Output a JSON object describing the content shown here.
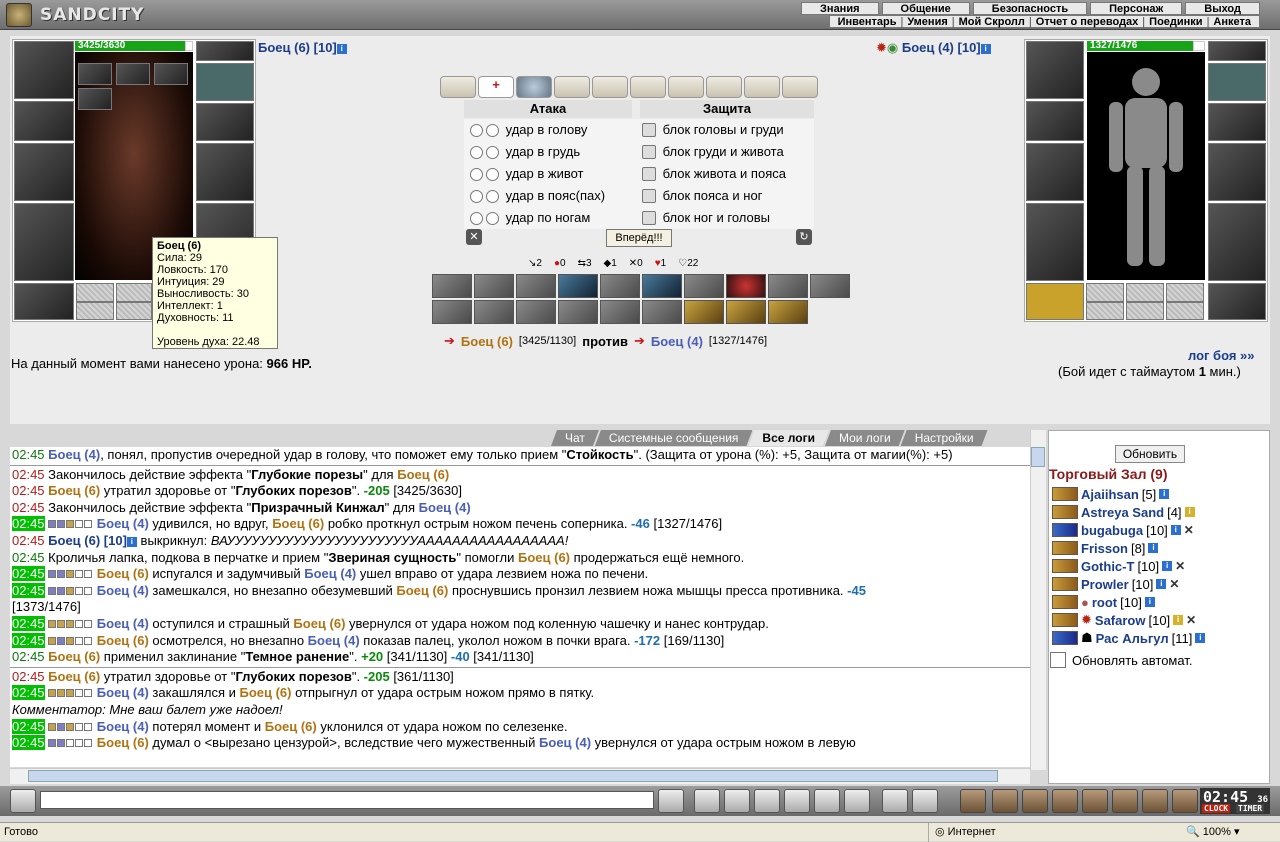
{
  "logo": "SANDCITY",
  "menu_top": [
    "Знания",
    "Общение",
    "Безопасность",
    "Персонаж",
    "Выход"
  ],
  "menu_sub": [
    "Инвентарь",
    "Умения",
    "Мой Скролл",
    "Отчет о переводах",
    "Поединки",
    "Анкета"
  ],
  "player_left": {
    "name": "Боец (6)",
    "level": "[10]",
    "hp": "3425/3630",
    "hp_fraction": 0.94
  },
  "player_right": {
    "name": "Боец (4)",
    "level": "[10]",
    "hp": "1327/1476",
    "hp_fraction": 0.9
  },
  "tooltip": {
    "name": "Боец (6)",
    "lines": [
      "Сила: 29",
      "Ловкость: 170",
      "Интуиция: 29",
      "Выносливость: 30",
      "Интеллект: 1",
      "Духовность: 11"
    ],
    "spirit": "Уровень духа: 22.48"
  },
  "attack": {
    "header": "Атака",
    "items": [
      "удар в голову",
      "удар в грудь",
      "удар в живот",
      "удар в пояс(пах)",
      "удар по ногам"
    ]
  },
  "defense": {
    "header": "Защита",
    "items": [
      "блок головы и груди",
      "блок груди и живота",
      "блок живота и пояса",
      "блок пояса и ног",
      "блок ног и головы"
    ]
  },
  "forward_button": "Вперёд!!!",
  "stats": [
    "2",
    "0",
    "3",
    "1",
    "0",
    "1",
    "22"
  ],
  "versus": {
    "left_name": "Боец (6)",
    "left_hp": "[3425/1130]",
    "word": "против",
    "right_name": "Боец (4)",
    "right_hp": "[1327/1476]"
  },
  "damage": {
    "text": "На данный момент вами нанесено урона:",
    "value": "966 HP."
  },
  "log_link": "лог боя »»",
  "timeout": {
    "before": "(Бой идет с таймаутом ",
    "value": "1",
    "after": " мин.)"
  },
  "tabs": [
    "Чат",
    "Системные сообщения",
    "Все логи",
    "Мои логи",
    "Настройки"
  ],
  "active_tab": "Все логи",
  "log_time": "02:45",
  "right_panel": {
    "refresh": "Обновить",
    "hall": "Торговый Зал (9)",
    "autorefresh": "Обновлять автомат."
  },
  "users": [
    {
      "nick": "Ajaiihsan",
      "lvl": "[5]"
    },
    {
      "nick": "Astreya Sand",
      "lvl": "[4]"
    },
    {
      "nick": "bugabuga",
      "lvl": "[10]"
    },
    {
      "nick": "Frisson",
      "lvl": "[8]"
    },
    {
      "nick": "Gothic-T",
      "lvl": "[10]"
    },
    {
      "nick": "Prowler",
      "lvl": "[10]"
    },
    {
      "nick": "root",
      "lvl": "[10]"
    },
    {
      "nick": "Safarow",
      "lvl": "[10]"
    },
    {
      "nick": "Рас Альгул",
      "lvl": "[11]"
    }
  ],
  "clock": "02:45",
  "clock_sec": "36",
  "clock_label": "CLOCK",
  "timer_label": "TIMER",
  "status": {
    "left": "Готово",
    "zone": "Интернет",
    "zoom": "100%"
  }
}
